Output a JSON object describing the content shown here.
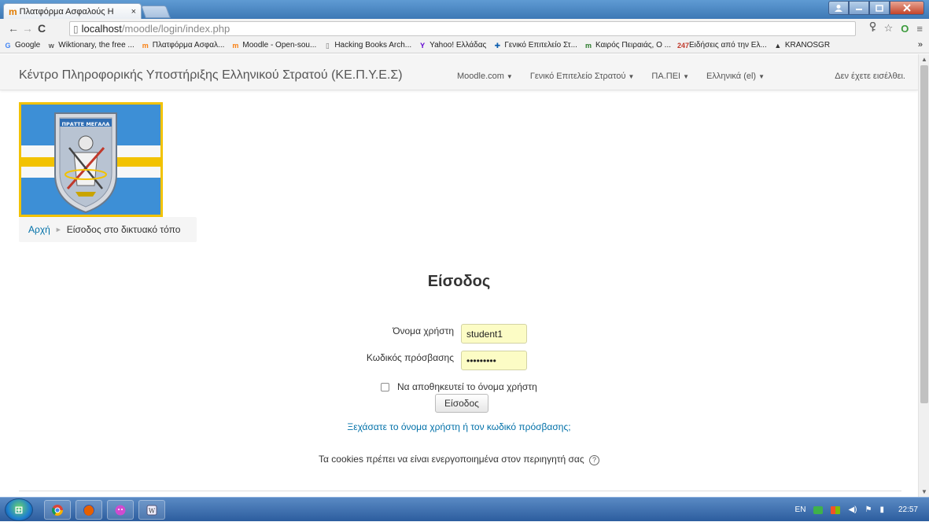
{
  "browser": {
    "tab_title": "Πλατφόρμα Ασφαλούς Η",
    "tab_close": "×",
    "url_host": "localhost",
    "url_path": "/moodle/login/index.php",
    "bookmarks": [
      {
        "icon": "google-icon",
        "glyph": "G",
        "label": "Google",
        "color": "#4285f4"
      },
      {
        "icon": "wiktionary-icon",
        "glyph": "w",
        "label": "Wiktionary, the free ...",
        "color": "#555555"
      },
      {
        "icon": "moodle-icon",
        "glyph": "m",
        "label": "Πλατφόρμα Ασφαλ...",
        "color": "#f98012"
      },
      {
        "icon": "moodle-icon",
        "glyph": "m",
        "label": "Moodle - Open-sou...",
        "color": "#f98012"
      },
      {
        "icon": "page-icon",
        "glyph": "▯",
        "label": "Hacking Books Arch...",
        "color": "#777777"
      },
      {
        "icon": "yahoo-icon",
        "glyph": "Y",
        "label": "Yahoo! Ελλάδας",
        "color": "#5f01d1"
      },
      {
        "icon": "flag-icon",
        "glyph": "✚",
        "label": "Γενικό Επιτελείο Στ...",
        "color": "#0d5eaf"
      },
      {
        "icon": "weather-icon",
        "glyph": "m",
        "label": "Καιρός Πειραιάς, Ο ...",
        "color": "#2a7a2a"
      },
      {
        "icon": "news-icon",
        "glyph": "247",
        "label": "Ειδήσεις από την Ελ...",
        "color": "#c0392b"
      },
      {
        "icon": "helmet-icon",
        "glyph": "▲",
        "label": "KRANOSGR",
        "color": "#333333"
      }
    ],
    "bookmarks_more": "»"
  },
  "navbar": {
    "brand": "Κέντρο Πληροφορικής Υποστήριξης Ελληνικού Στρατού (ΚΕ.Π.Υ.Ε.Σ)",
    "menu": [
      "Moodle.com",
      "Γενικό Επιτελείο Στρατού",
      "ΠΑ.ΠΕΙ",
      "Ελληνικά (el)"
    ],
    "login_info": "Δεν έχετε εισέλθει."
  },
  "logo": {
    "motto": "ΠΡΑΤΤΕ ΜΕΓΑΛΑ"
  },
  "breadcrumb": {
    "home": "Αρχή",
    "current": "Είσοδος στο δικτυακό τόπο"
  },
  "login": {
    "title": "Είσοδος",
    "username_label": "Όνομα χρήστη",
    "username_value": "student1",
    "password_label": "Κωδικός πρόσβασης",
    "password_value": "•••••••••",
    "remember_label": "Να αποθηκευτεί το όνομα χρήστη",
    "submit_label": "Είσοδος",
    "forgot_link": "Ξεχάσατε το όνομα χρήστη ή τον κωδικό πρόσβασης;",
    "cookies_note": "Τα cookies πρέπει να είναι ενεργοποιημένα στον περιηγητή σας"
  },
  "taskbar": {
    "lang": "EN",
    "time": "22:57"
  },
  "colors": {
    "link": "#0070a8",
    "input_bg": "#fcfcc5",
    "navbar_bg": "#f5f5f5"
  }
}
